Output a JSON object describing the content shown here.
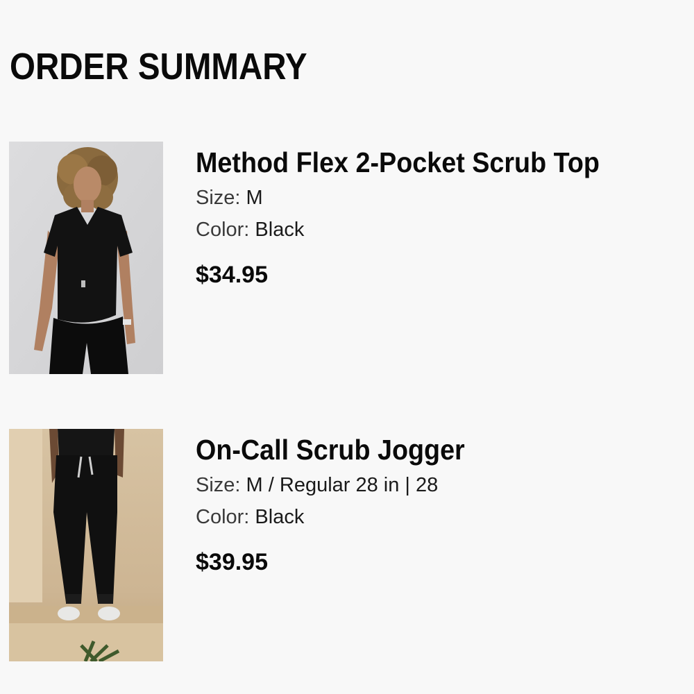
{
  "page": {
    "title": "ORDER SUMMARY"
  },
  "labels": {
    "size": "Size:",
    "color": "Color:"
  },
  "items": [
    {
      "name": "Method Flex 2-Pocket Scrub Top",
      "size": "M",
      "color": "Black",
      "price": "$34.95",
      "image": "woman-in-black-scrub-top-photo"
    },
    {
      "name": "On-Call Scrub Jogger",
      "size": "M / Regular 28 in | 28",
      "color": "Black",
      "price": "$39.95",
      "image": "black-scrub-jogger-photo"
    }
  ],
  "colors": {
    "background": "#f8f8f8",
    "text": "#0a0a0a"
  }
}
